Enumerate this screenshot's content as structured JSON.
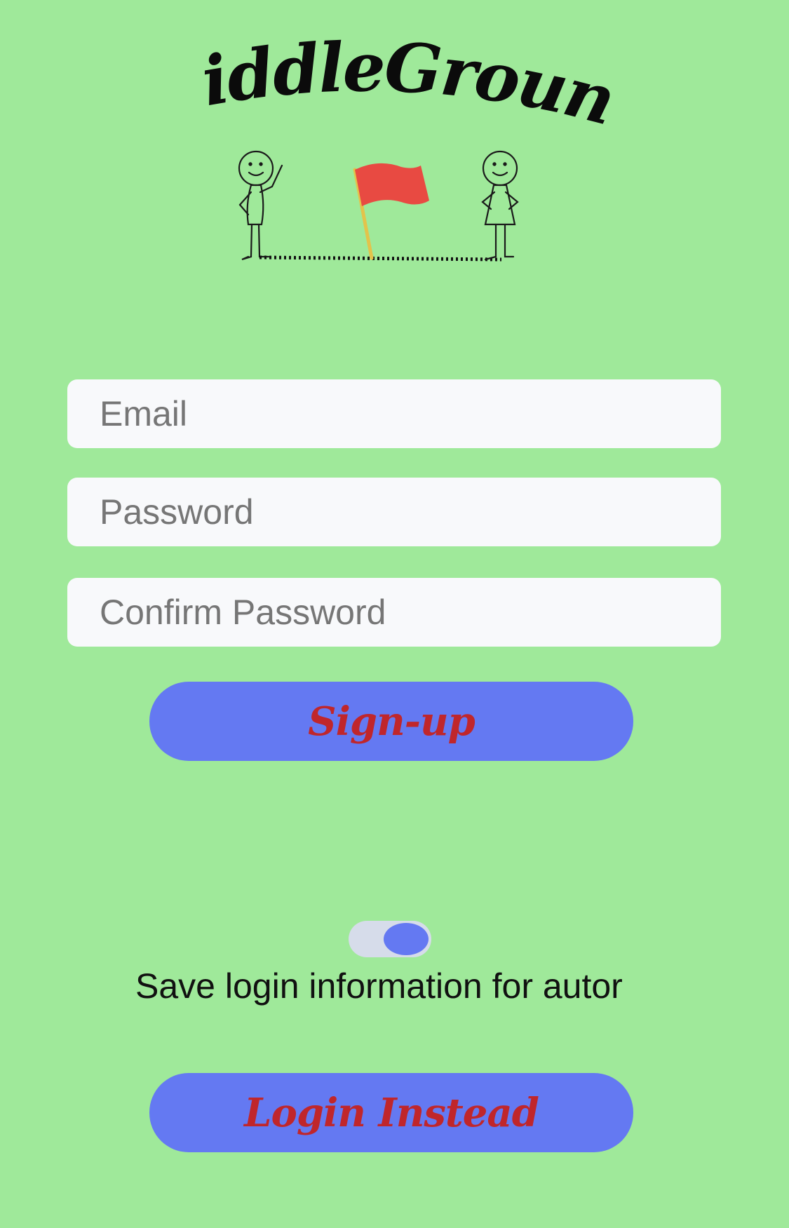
{
  "app": {
    "logo_title": "MiddleGround"
  },
  "form": {
    "email_placeholder": "Email",
    "password_placeholder": "Password",
    "confirm_placeholder": "Confirm Password"
  },
  "buttons": {
    "signup_label": "Sign-up",
    "login_instead_label": "Login Instead"
  },
  "save_login": {
    "label": "Save login information for autor",
    "toggle_on": true
  },
  "colors": {
    "background": "#9fe99a",
    "button": "#6479f2",
    "button_text": "#c0262b",
    "field": "#f8f9fb",
    "flag": "#e84a42"
  },
  "icons": {
    "logo": "middleground-logo-icon",
    "flag": "flag-icon",
    "person_left": "stick-figure-icon",
    "person_right": "stick-figure-icon"
  }
}
